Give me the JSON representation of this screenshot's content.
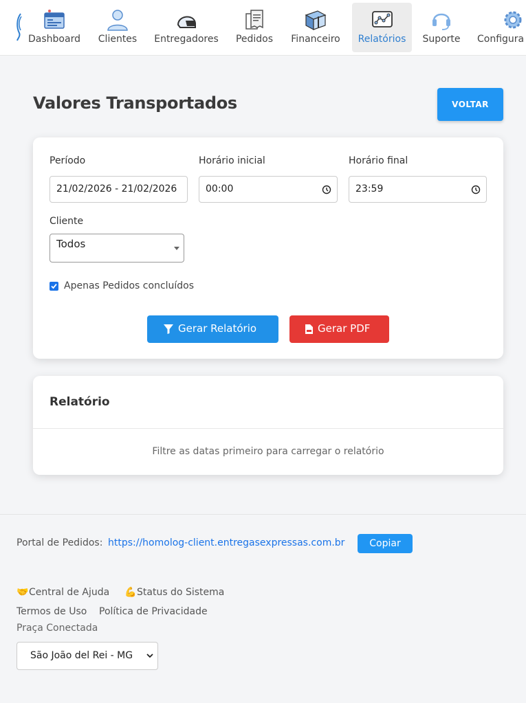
{
  "nav": {
    "items": [
      {
        "label": "Dashboard",
        "icon": "dashboard-icon"
      },
      {
        "label": "Clientes",
        "icon": "user-icon"
      },
      {
        "label": "Entregadores",
        "icon": "helmet-icon"
      },
      {
        "label": "Pedidos",
        "icon": "receipt-icon"
      },
      {
        "label": "Financeiro",
        "icon": "money-stack-icon"
      },
      {
        "label": "Relatórios",
        "icon": "chart-icon"
      },
      {
        "label": "Suporte",
        "icon": "headset-icon"
      },
      {
        "label": "Configura",
        "icon": "gear-icon"
      }
    ],
    "active": "Relatórios"
  },
  "page": {
    "title": "Valores Transportados",
    "back_label": "VOLTAR"
  },
  "filters": {
    "periodo_label": "Período",
    "periodo_value": "21/02/2026 - 21/02/2026",
    "horario_inicial_label": "Horário inicial",
    "horario_inicial_value": "00:00",
    "horario_final_label": "Horário final",
    "horario_final_value": "23:59",
    "cliente_label": "Cliente",
    "cliente_value": "Todos",
    "apenas_concluidos_label": "Apenas Pedidos concluídos",
    "apenas_concluidos_checked": true,
    "gerar_relatorio_label": "Gerar Relatório",
    "gerar_pdf_label": "Gerar PDF"
  },
  "report": {
    "title": "Relatório",
    "empty_message": "Filtre as datas primeiro para carregar o relatório"
  },
  "footer": {
    "portal_label": "Portal de Pedidos:",
    "portal_url": "https://homolog-client.entregasexpressas.com.br",
    "copy_label": "Copiar",
    "help_emoji": "🤝",
    "help_label": "Central de Ajuda",
    "status_emoji": "💪",
    "status_label": "Status do Sistema",
    "terms_label": "Termos de Uso",
    "privacy_label": "Política de Privacidade",
    "praca_label": "Praça Conectada",
    "praca_value": "São João del Rei - MG"
  },
  "colors": {
    "primary": "#2196f3",
    "danger": "#e53935",
    "link": "#1a73e8",
    "active_nav_text": "#2f7fd0"
  }
}
